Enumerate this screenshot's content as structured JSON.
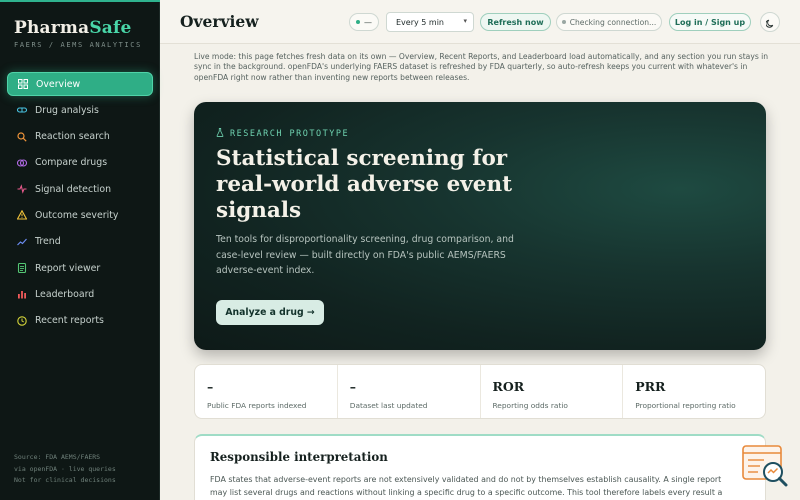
{
  "brand": {
    "name_part1": "Pharma",
    "name_part2": "Safe",
    "subtitle": "FAERS / AEMS ANALYTICS"
  },
  "nav": [
    {
      "label": "Overview",
      "icon": "grid-icon",
      "color": "#ffffff",
      "active": true
    },
    {
      "label": "Drug analysis",
      "icon": "pill-icon",
      "color": "#49c6e5"
    },
    {
      "label": "Reaction search",
      "icon": "search-icon",
      "color": "#f0953a"
    },
    {
      "label": "Compare drugs",
      "icon": "compare-icon",
      "color": "#b26ae6"
    },
    {
      "label": "Signal detection",
      "icon": "activity-icon",
      "color": "#e85a8c"
    },
    {
      "label": "Outcome severity",
      "icon": "warning-icon",
      "color": "#f0c23a"
    },
    {
      "label": "Trend",
      "icon": "trend-icon",
      "color": "#6b8cf0"
    },
    {
      "label": "Report viewer",
      "icon": "document-icon",
      "color": "#54c774"
    },
    {
      "label": "Leaderboard",
      "icon": "bar-chart-icon",
      "color": "#f05a5a"
    },
    {
      "label": "Recent reports",
      "icon": "clock-icon",
      "color": "#d6d63a"
    }
  ],
  "sidebar_footer": {
    "line1": "Source: FDA AEMS/FAERS",
    "line2": "via openFDA · live queries",
    "line3": "Not for clinical decisions"
  },
  "header": {
    "title": "Overview",
    "status_pill": "—",
    "interval_selected": "Every 5 min",
    "refresh_label": "Refresh now",
    "connection_status": "Checking connection...",
    "login_label": "Log in / Sign up"
  },
  "live_note": "Live mode: this page fetches fresh data on its own — Overview, Recent Reports, and Leaderboard load automatically, and any section you run stays in sync in the background. openFDA's underlying FAERS dataset is refreshed by FDA quarterly, so auto-refresh keeps you current with whatever's in openFDA right now rather than inventing new reports between releases.",
  "hero": {
    "tag": "RESEARCH PROTOTYPE",
    "title": "Statistical screening for real-world adverse event signals",
    "description": "Ten tools for disproportionality screening, drug comparison, and case-level review — built directly on FDA's public AEMS/FAERS adverse-event index.",
    "cta_label": "Analyze a drug →"
  },
  "stats": [
    {
      "value": "–",
      "label": "Public FDA reports indexed"
    },
    {
      "value": "–",
      "label": "Dataset last updated"
    },
    {
      "value": "ROR",
      "label": "Reporting odds ratio"
    },
    {
      "value": "PRR",
      "label": "Proportional reporting ratio"
    }
  ],
  "interpretation": {
    "title": "Responsible interpretation",
    "body": "FDA states that adverse-event reports are not extensively validated and do not by themselves establish causality. A single report may list several drugs and reactions without linking a specific drug to a specific outcome. This tool therefore labels every result a"
  },
  "colors": {
    "accent": "#2fae86",
    "sidebar_bg": "#0e1715",
    "page_bg": "#f3f1ea"
  }
}
